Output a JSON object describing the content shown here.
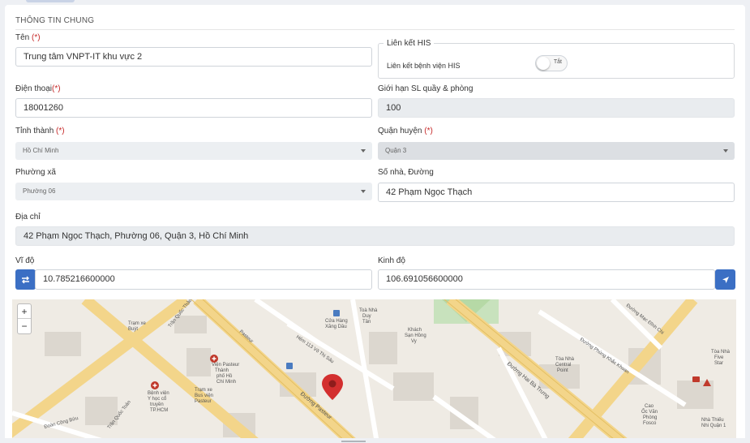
{
  "section_title": "THÔNG TIN CHUNG",
  "fields": {
    "ten": {
      "label": "Tên",
      "required_mark": "(*)",
      "value": "Trung tâm VNPT-IT khu vực 2"
    },
    "his": {
      "legend": "Liên kết HIS",
      "label": "Liên kết bệnh viện HIS",
      "toggle_text": "Tắt"
    },
    "dien_thoai": {
      "label": "Điện thoại",
      "required_mark": "(*)",
      "value": "18001260"
    },
    "gioi_han": {
      "label": "Giới hạn SL quầy & phòng",
      "value": "100"
    },
    "tinh_thanh": {
      "label": "Tỉnh thành",
      "required_mark": "(*)",
      "value": "Hồ Chí Minh"
    },
    "quan_huyen": {
      "label": "Quận huyện",
      "required_mark": "(*)",
      "value": "Quận 3"
    },
    "phuong_xa": {
      "label": "Phường xã",
      "value": "Phường 06"
    },
    "so_nha": {
      "label": "Số nhà, Đường",
      "value": "42 Phạm Ngọc Thạch"
    },
    "dia_chi": {
      "label": "Địa chỉ",
      "value": "42 Phạm Ngọc Thạch, Phường 06, Quận 3, Hồ Chí Minh"
    },
    "vi_do": {
      "label": "Vĩ độ",
      "value": "10.785216600000"
    },
    "kinh_do": {
      "label": "Kinh độ",
      "value": "106.691056600000"
    }
  },
  "map": {
    "zoom_in": "+",
    "zoom_out": "−",
    "labels": {
      "tram_xe_bus_nha_tho": "Trạm xe Buýt",
      "vien_pasteur": "Viện Pasteur Thành phố Hồ Chí Minh",
      "benh_vien": "Bệnh viện Y học cổ truyền TP.HCM",
      "tram_xe_bus_vien": "Trạm xe Bus viện Pasteur",
      "cua_hang": "Cửa Hàng Xăng Dầu",
      "toa_nha": "Toà Nhà Duy Tân",
      "khach_san": "Khách Sạn Hồng Vy",
      "duong_pasteur": "Đường Pasteur",
      "hem": "Hẻm 113 Võ Thị Sáu",
      "duong_hbt": "Đường Hai Bà Trưng",
      "duong_pkk": "Đường Phùng Khắc Khoan",
      "duong_mdc": "Đường Mạc Đĩnh Chi",
      "duong_dcb": "Đoàn Công Bửu",
      "tran_quoc_toan": "Trần Quốc Toản",
      "tran_quoc_thao": "Trần Quốc Thảo",
      "toa_nha_central": "Tòa Nhà Central Point",
      "cao_oc_van_phong": "Cao Ốc Văn Phòng Fosco",
      "nha_thieu_nhi": "Nhà Thiếu Nhi Quận 1",
      "toa_nha_five_star": "Tòa Nhà Five Star"
    }
  },
  "colors": {
    "primary": "#3b6fc4",
    "required": "#c62828",
    "marker": "#d32f2f"
  }
}
